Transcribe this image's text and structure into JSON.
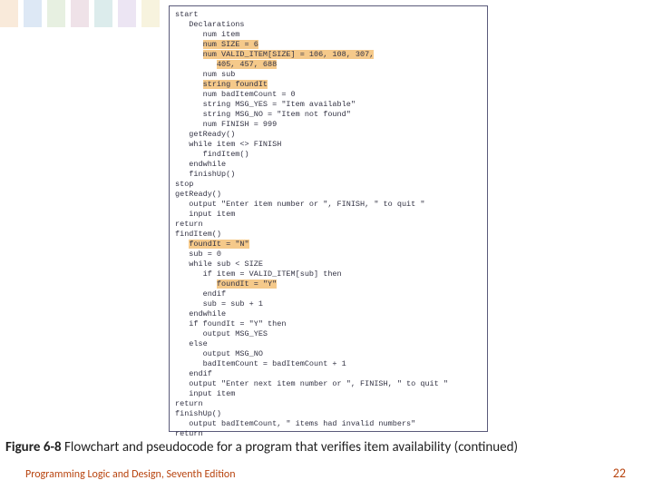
{
  "bg_colors": [
    "#e8b070",
    "#7aa8d8",
    "#a2c48a",
    "#c08fa8",
    "#78b8b8",
    "#b89ad0",
    "#e0d080"
  ],
  "code": {
    "lines": [
      {
        "indent": 0,
        "text": "start"
      },
      {
        "indent": 1,
        "text": "Declarations"
      },
      {
        "indent": 2,
        "text": "num item"
      },
      {
        "indent": 2,
        "text": "num SIZE = 6",
        "hl": true
      },
      {
        "indent": 2,
        "text": "num VALID_ITEM[SIZE] = 106, 108, 307,",
        "hl": true
      },
      {
        "indent": 3,
        "text": "405, 457, 688",
        "hl": true
      },
      {
        "indent": 2,
        "text": "num sub"
      },
      {
        "indent": 2,
        "text": "string foundIt",
        "hl": true
      },
      {
        "indent": 2,
        "text": "num badItemCount = 0"
      },
      {
        "indent": 2,
        "text": "string MSG_YES = \"Item available\""
      },
      {
        "indent": 2,
        "text": "string MSG_NO = \"Item not found\""
      },
      {
        "indent": 2,
        "text": "num FINISH = 999"
      },
      {
        "indent": 1,
        "text": "getReady()"
      },
      {
        "indent": 1,
        "text": "while item <> FINISH"
      },
      {
        "indent": 2,
        "text": "findItem()"
      },
      {
        "indent": 1,
        "text": "endwhile"
      },
      {
        "indent": 1,
        "text": "finishUp()"
      },
      {
        "indent": 0,
        "text": "stop"
      },
      {
        "indent": 0,
        "text": ""
      },
      {
        "indent": 0,
        "text": "getReady()"
      },
      {
        "indent": 1,
        "text": "output \"Enter item number or \", FINISH, \" to quit \""
      },
      {
        "indent": 1,
        "text": "input item"
      },
      {
        "indent": 0,
        "text": "return"
      },
      {
        "indent": 0,
        "text": ""
      },
      {
        "indent": 0,
        "text": "findItem()"
      },
      {
        "indent": 1,
        "text": "foundIt = \"N\"",
        "hl": true
      },
      {
        "indent": 1,
        "text": "sub = 0"
      },
      {
        "indent": 1,
        "text": "while sub < SIZE"
      },
      {
        "indent": 2,
        "text": "if item = VALID_ITEM[sub] then"
      },
      {
        "indent": 3,
        "text": "foundIt = \"Y\"",
        "hl": true
      },
      {
        "indent": 2,
        "text": "endif"
      },
      {
        "indent": 2,
        "text": "sub = sub + 1"
      },
      {
        "indent": 1,
        "text": "endwhile"
      },
      {
        "indent": 1,
        "text": "if foundIt = \"Y\" then"
      },
      {
        "indent": 2,
        "text": "output MSG_YES"
      },
      {
        "indent": 1,
        "text": "else"
      },
      {
        "indent": 2,
        "text": "output MSG_NO"
      },
      {
        "indent": 2,
        "text": "badItemCount = badItemCount + 1"
      },
      {
        "indent": 1,
        "text": "endif"
      },
      {
        "indent": 1,
        "text": "output \"Enter next item number or \", FINISH, \" to quit \""
      },
      {
        "indent": 1,
        "text": "input item"
      },
      {
        "indent": 0,
        "text": "return"
      },
      {
        "indent": 0,
        "text": ""
      },
      {
        "indent": 0,
        "text": "finishUp()"
      },
      {
        "indent": 1,
        "text": "output badItemCount, \" items had invalid numbers\""
      },
      {
        "indent": 0,
        "text": "return"
      }
    ]
  },
  "caption": {
    "figno": "Figure 6-8",
    "text": "  Flowchart and pseudocode for a program that verifies item availability (continued)"
  },
  "footer": {
    "left": "Programming Logic and Design, Seventh Edition",
    "right": "22"
  }
}
